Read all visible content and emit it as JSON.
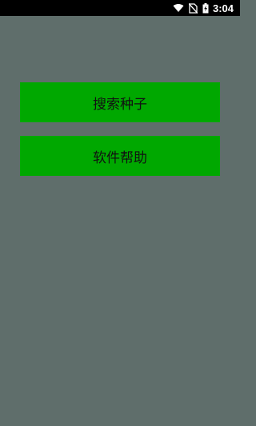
{
  "status_bar": {
    "time": "3:04",
    "icons": [
      "wifi-icon",
      "no-sim-icon",
      "battery-charging-icon"
    ]
  },
  "buttons": {
    "search_seed": "搜索种子",
    "help": "软件帮助"
  },
  "colors": {
    "background": "#5f6e6b",
    "button": "#00a800",
    "status_bar": "#000000"
  }
}
